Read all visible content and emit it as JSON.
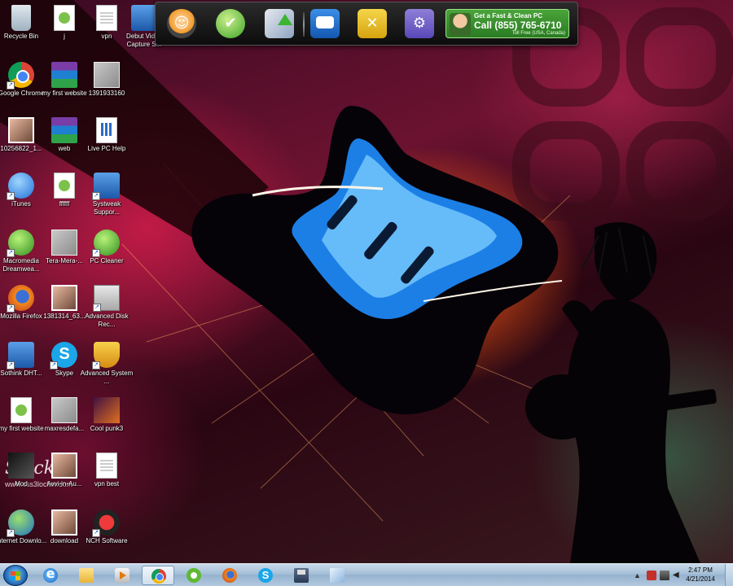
{
  "desktop": {
    "icons": [
      {
        "label": "Recycle Bin",
        "icon": "recycle-bin-icon"
      },
      {
        "label": "j",
        "icon": "dreamweaver-file-icon"
      },
      {
        "label": "vpn",
        "icon": "text-file-icon"
      },
      {
        "label": "Debut Video Capture S...",
        "icon": "debut-video-capture-icon"
      },
      {
        "label": "Google Chrome",
        "icon": "chrome-icon"
      },
      {
        "label": "my first website",
        "icon": "winrar-archive-icon"
      },
      {
        "label": "1391933160",
        "icon": "image-file-icon"
      },
      {
        "label": "10256822_1...",
        "icon": "photo-icon"
      },
      {
        "label": "web",
        "icon": "winrar-archive-icon"
      },
      {
        "label": "Live PC Help",
        "icon": "live-pc-help-icon"
      },
      {
        "label": "iTunes",
        "icon": "itunes-icon"
      },
      {
        "label": "ffffff",
        "icon": "dreamweaver-file-icon"
      },
      {
        "label": "Systweak Suppor...",
        "icon": "systweak-support-icon"
      },
      {
        "label": "Macromedia Dreamwea...",
        "icon": "dreamweaver-icon"
      },
      {
        "label": "Tera-Mera-...",
        "icon": "video-thumbnail-icon"
      },
      {
        "label": "PC Cleaner",
        "icon": "pc-cleaner-icon"
      },
      {
        "label": "Mozilla Firefox",
        "icon": "firefox-icon"
      },
      {
        "label": "1381314_63...",
        "icon": "photo-icon"
      },
      {
        "label": "Advanced Disk Rec...",
        "icon": "advanced-disk-recovery-icon"
      },
      {
        "label": "Sothink DHT...",
        "icon": "sothink-dhtml-icon"
      },
      {
        "label": "Skype",
        "icon": "skype-icon"
      },
      {
        "label": "Advanced System ...",
        "icon": "advanced-system-protector-icon"
      },
      {
        "label": "my first website",
        "icon": "dreamweaver-file-icon"
      },
      {
        "label": "maxresdefa...",
        "icon": "image-file-icon"
      },
      {
        "label": "Cool punk3",
        "icon": "image-file-icon"
      },
      {
        "label": "Mod",
        "icon": "clocker-icon"
      },
      {
        "label": "Avvi-in-Au...",
        "icon": "photo-icon"
      },
      {
        "label": "vpn best",
        "icon": "text-file-icon"
      },
      {
        "label": "Internet Downlo...",
        "icon": "internet-download-manager-icon"
      },
      {
        "label": "download",
        "icon": "photo-icon"
      },
      {
        "label": "NCH Software",
        "icon": "nch-software-icon"
      }
    ],
    "watermark": "www.css3locker.com",
    "clocker_text": "Slocker"
  },
  "toolbar": {
    "buttons": [
      {
        "name": "support",
        "icon": "headset-support-icon"
      },
      {
        "name": "cleaner",
        "icon": "broom-cleaner-icon"
      },
      {
        "name": "update",
        "icon": "upload-arrow-icon"
      },
      {
        "name": "chat",
        "icon": "chat-bubble-icon"
      },
      {
        "name": "tools",
        "icon": "wrench-screwdriver-icon"
      },
      {
        "name": "settings",
        "icon": "gear-icon"
      }
    ],
    "promo": {
      "line1": "Get a Fast & Clean PC",
      "call": "Call",
      "phone": "(855) 765-6710",
      "line3": "Toll Free (USA, Canada)"
    }
  },
  "taskbar": {
    "start_icon": "windows-start-icon",
    "apps": [
      {
        "name": "internet-explorer",
        "icon": "internet-explorer-icon"
      },
      {
        "name": "file-explorer",
        "icon": "folder-icon"
      },
      {
        "name": "media-player",
        "icon": "media-player-icon"
      },
      {
        "name": "chrome",
        "icon": "chrome-icon",
        "active": true
      },
      {
        "name": "dreamweaver",
        "icon": "dreamweaver-icon"
      },
      {
        "name": "firefox",
        "icon": "firefox-icon"
      },
      {
        "name": "skype",
        "icon": "skype-icon"
      },
      {
        "name": "save-app",
        "icon": "floppy-disk-icon"
      },
      {
        "name": "paint",
        "icon": "paint-icon"
      }
    ],
    "clock": {
      "time": "2:47 PM",
      "date": "4/21/2014"
    }
  },
  "colors": {
    "promo_green": "#2f8a26",
    "taskbar": "#a5bfd7",
    "toolbar": "#111111"
  }
}
